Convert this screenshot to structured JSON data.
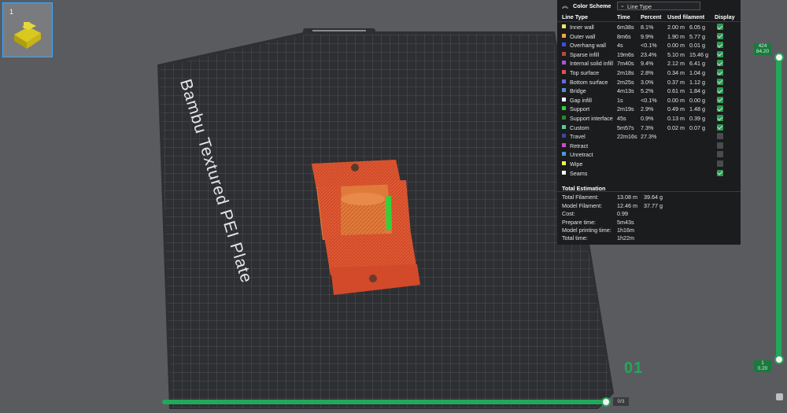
{
  "thumbnail": {
    "plate_number": "1"
  },
  "plate": {
    "label": "Bambu Textured PEI Plate",
    "index_label": "01"
  },
  "color_scheme": {
    "title": "Color Scheme",
    "selected": "Line Type",
    "collapse_icon": "double-chevron-up-icon",
    "columns": [
      "Line Type",
      "Time",
      "Percent",
      "Used filament",
      "Display"
    ],
    "rows": [
      {
        "name": "Inner wall",
        "color": "#f2e56a",
        "time": "6m38s",
        "percent": "8.1%",
        "len": "2.00 m",
        "weight": "6.05 g",
        "display": true
      },
      {
        "name": "Outer wall",
        "color": "#f2a54a",
        "time": "8m6s",
        "percent": "9.9%",
        "len": "1.90 m",
        "weight": "5.77 g",
        "display": true
      },
      {
        "name": "Overhang wall",
        "color": "#3a4fe0",
        "time": "4s",
        "percent": "<0.1%",
        "len": "0.00 m",
        "weight": "0.01 g",
        "display": true
      },
      {
        "name": "Sparse infill",
        "color": "#b84a3a",
        "time": "19m6s",
        "percent": "23.4%",
        "len": "5.10 m",
        "weight": "15.46 g",
        "display": true
      },
      {
        "name": "Internal solid infill",
        "color": "#a855d8",
        "time": "7m40s",
        "percent": "9.4%",
        "len": "2.12 m",
        "weight": "6.41 g",
        "display": true
      },
      {
        "name": "Top surface",
        "color": "#e85050",
        "time": "2m18s",
        "percent": "2.8%",
        "len": "0.34 m",
        "weight": "1.04 g",
        "display": true
      },
      {
        "name": "Bottom surface",
        "color": "#6a6ad8",
        "time": "2m25s",
        "percent": "3.0%",
        "len": "0.37 m",
        "weight": "1.12 g",
        "display": true
      },
      {
        "name": "Bridge",
        "color": "#5a8ad8",
        "time": "4m13s",
        "percent": "5.2%",
        "len": "0.61 m",
        "weight": "1.84 g",
        "display": true
      },
      {
        "name": "Gap infill",
        "color": "#ffffff",
        "time": "1s",
        "percent": "<0.1%",
        "len": "0.00 m",
        "weight": "0.00 g",
        "display": true
      },
      {
        "name": "Support",
        "color": "#34d03a",
        "time": "2m19s",
        "percent": "2.9%",
        "len": "0.49 m",
        "weight": "1.48 g",
        "display": true
      },
      {
        "name": "Support interface",
        "color": "#2a8a2a",
        "time": "45s",
        "percent": "0.9%",
        "len": "0.13 m",
        "weight": "0.39 g",
        "display": true
      },
      {
        "name": "Custom",
        "color": "#5ac8a0",
        "time": "5m57s",
        "percent": "7.3%",
        "len": "0.02 m",
        "weight": "0.07 g",
        "display": true
      },
      {
        "name": "Travel",
        "color": "#3a4a9a",
        "time": "22m16s",
        "percent": "27.3%",
        "len": "",
        "weight": "",
        "display": false
      },
      {
        "name": "Retract",
        "color": "#d04ad0",
        "time": "",
        "percent": "",
        "len": "",
        "weight": "",
        "display": false
      },
      {
        "name": "Unretract",
        "color": "#4a9ad8",
        "time": "",
        "percent": "",
        "len": "",
        "weight": "",
        "display": false
      },
      {
        "name": "Wipe",
        "color": "#f2f24a",
        "time": "",
        "percent": "",
        "len": "",
        "weight": "",
        "display": false
      },
      {
        "name": "Seams",
        "color": "#f2f2f2",
        "time": "",
        "percent": "",
        "len": "",
        "weight": "",
        "display": true
      }
    ]
  },
  "total_estimation": {
    "title": "Total Estimation",
    "total_filament_label": "Total Filament:",
    "total_filament_len": "13.08 m",
    "total_filament_weight": "39.64 g",
    "model_filament_label": "Model Filament:",
    "model_filament_len": "12.46 m",
    "model_filament_weight": "37.77 g",
    "cost_label": "Cost:",
    "cost": "0.99",
    "prepare_label": "Prepare time:",
    "prepare": "5m43s",
    "model_print_label": "Model printing time:",
    "model_print": "1h16m",
    "total_time_label": "Total time:",
    "total_time": "1h22m"
  },
  "layer_slider": {
    "top_layer": "424",
    "top_height": "84.20",
    "bottom_layer": "1",
    "bottom_height": "0.20"
  },
  "move_slider": {
    "value_label": "0/3"
  }
}
